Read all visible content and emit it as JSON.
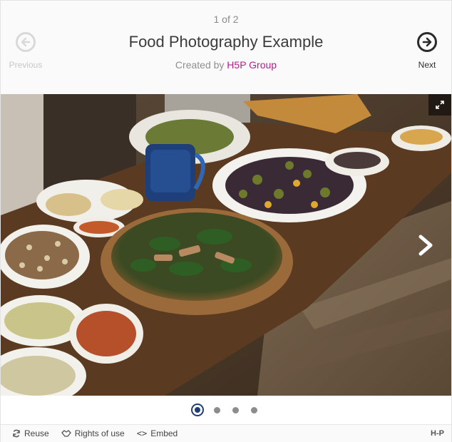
{
  "header": {
    "counter": "1 of 2",
    "title": "Food Photography Example",
    "created_by_prefix": "Created by ",
    "author": "H5P Group",
    "previous_label": "Previous",
    "next_label": "Next"
  },
  "image": {
    "description_icon": "food-table-photo"
  },
  "pagination": {
    "dot_count": 4,
    "active_index": 0
  },
  "footer": {
    "reuse_label": "Reuse",
    "rights_label": "Rights of use",
    "embed_label": "Embed",
    "brand": "H-P"
  },
  "colors": {
    "author_link": "#b31e8d",
    "active_dot": "#1f3e70"
  }
}
